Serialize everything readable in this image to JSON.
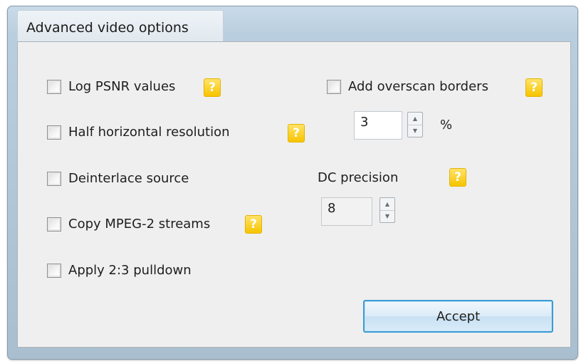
{
  "dialog": {
    "title": "Advanced video options"
  },
  "options": {
    "log_psnr": {
      "label": "Log PSNR values",
      "checked": false
    },
    "half_horizontal": {
      "label": "Half horizontal resolution",
      "checked": false
    },
    "deinterlace": {
      "label": "Deinterlace source",
      "checked": false
    },
    "copy_mpeg2": {
      "label": "Copy MPEG-2 streams",
      "checked": false
    },
    "pulldown": {
      "label": "Apply 2:3 pulldown",
      "checked": false
    },
    "overscan": {
      "label": "Add overscan borders",
      "checked": false
    }
  },
  "overscan_value": {
    "value": "3",
    "unit": "%"
  },
  "dc_precision": {
    "label": "DC precision",
    "value": "8"
  },
  "help_icon": {
    "glyph": "?",
    "color": "#f7c400"
  },
  "buttons": {
    "accept_label": "Accept"
  },
  "colors": {
    "frame": "#b9cede",
    "panel": "#efefef",
    "accent": "#3c9bd2"
  }
}
